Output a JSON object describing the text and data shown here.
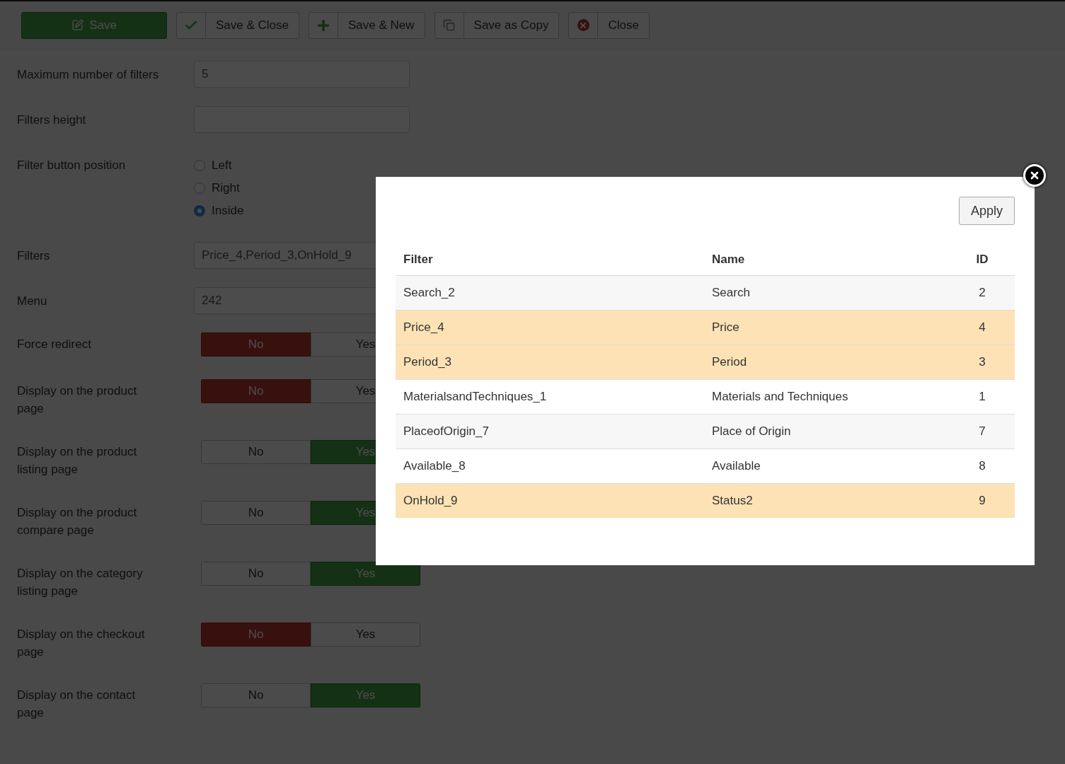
{
  "toolbar": [
    {
      "kind": "primary",
      "label": "Save"
    },
    {
      "kind": "split",
      "label": "Save & Close"
    },
    {
      "kind": "split",
      "label": "Save & New"
    },
    {
      "kind": "split",
      "label": "Save as Copy"
    },
    {
      "kind": "split",
      "label": "Close"
    }
  ],
  "form": [
    {
      "kind": "text",
      "label": "Maximum number of filters",
      "value": "5"
    },
    {
      "kind": "text",
      "label": "Filters height"
    },
    {
      "kind": "radio",
      "label": "Filter button position",
      "options": [
        {
          "label": "Left",
          "selected": false
        },
        {
          "label": "Right",
          "selected": false
        },
        {
          "label": "Inside",
          "selected": true
        }
      ]
    },
    {
      "kind": "text",
      "label": "Filters",
      "value": "Price_4,Period_3,OnHold_9"
    },
    {
      "kind": "text",
      "label": "Menu",
      "value": "242"
    },
    {
      "kind": "toggle",
      "label": "Force redirect",
      "options": [
        {
          "label": "No",
          "selected": true
        },
        {
          "label": "Yes",
          "selected": false
        }
      ]
    },
    {
      "kind": "toggle",
      "label": "Display on the product page",
      "options": [
        {
          "label": "No",
          "selected": true
        },
        {
          "label": "Yes",
          "selected": false
        }
      ]
    },
    {
      "kind": "toggle",
      "label": "Display on the product listing page",
      "options": [
        {
          "label": "No",
          "selected": false
        },
        {
          "label": "Yes",
          "selected": true
        }
      ]
    },
    {
      "kind": "toggle",
      "label": "Display on the product compare page",
      "options": [
        {
          "label": "No",
          "selected": false
        },
        {
          "label": "Yes",
          "selected": true
        }
      ]
    },
    {
      "kind": "toggle",
      "label": "Display on the category listing page",
      "options": [
        {
          "label": "No",
          "selected": false
        },
        {
          "label": "Yes",
          "selected": true
        }
      ]
    },
    {
      "kind": "toggle",
      "label": "Display on the checkout page",
      "options": [
        {
          "label": "No",
          "selected": true
        },
        {
          "label": "Yes",
          "selected": false
        }
      ]
    },
    {
      "kind": "toggle",
      "label": "Display on the contact page",
      "options": [
        {
          "label": "No",
          "selected": false
        },
        {
          "label": "Yes",
          "selected": true
        }
      ]
    }
  ],
  "modal": {
    "apply": "Apply",
    "columns": [
      "Filter",
      "Name",
      "ID"
    ],
    "rows": [
      {
        "cells": [
          "Search_2",
          "Search",
          "2"
        ],
        "selected": false
      },
      {
        "cells": [
          "Price_4",
          "Price",
          "4"
        ],
        "selected": true
      },
      {
        "cells": [
          "Period_3",
          "Period",
          "3"
        ],
        "selected": true
      },
      {
        "cells": [
          "MaterialsandTechniques_1",
          "Materials and Techniques",
          "1"
        ],
        "selected": false
      },
      {
        "cells": [
          "PlaceofOrigin_7",
          "Place of Origin",
          "7"
        ],
        "selected": false
      },
      {
        "cells": [
          "Available_8",
          "Available",
          "8"
        ],
        "selected": false
      },
      {
        "cells": [
          "OnHold_9",
          "Status2",
          "9"
        ],
        "selected": true
      }
    ]
  }
}
